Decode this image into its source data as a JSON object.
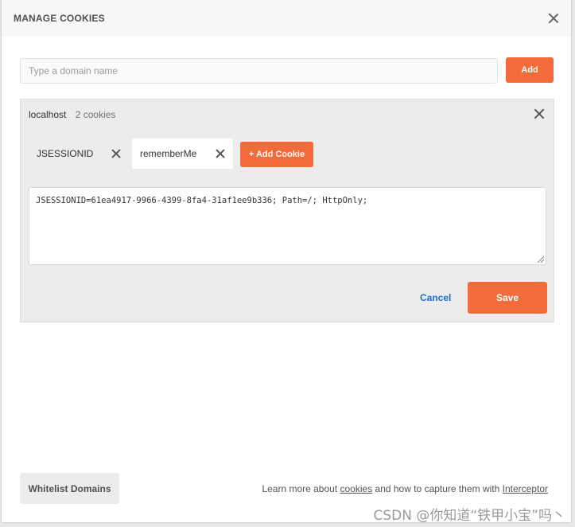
{
  "modal": {
    "title": "MANAGE COOKIES",
    "close_icon": "close-icon"
  },
  "domain_search": {
    "placeholder": "Type a domain name",
    "value": "",
    "add_label": "Add"
  },
  "domain": {
    "name": "localhost",
    "count": "2 cookies",
    "cookies": [
      {
        "name": "JSESSIONID",
        "selected": false
      },
      {
        "name": "rememberMe",
        "selected": true
      }
    ],
    "add_cookie_label": "+ Add Cookie",
    "editor_value": "JSESSIONID=61ea4917-9966-4399-8fa4-31af1ee9b336; Path=/; HttpOnly;",
    "cancel_label": "Cancel",
    "save_label": "Save"
  },
  "footer": {
    "whitelist_label": "Whitelist Domains",
    "learn_prefix": "Learn more about ",
    "cookies_link": "cookies",
    "learn_middle": " and how to capture them with ",
    "interceptor_link": "Interceptor"
  },
  "watermark": "CSDN @你知道“铁甲小宝”吗丶",
  "colors": {
    "accent": "#f26b3a",
    "link": "#1a6fcf",
    "panel": "#ececec"
  }
}
